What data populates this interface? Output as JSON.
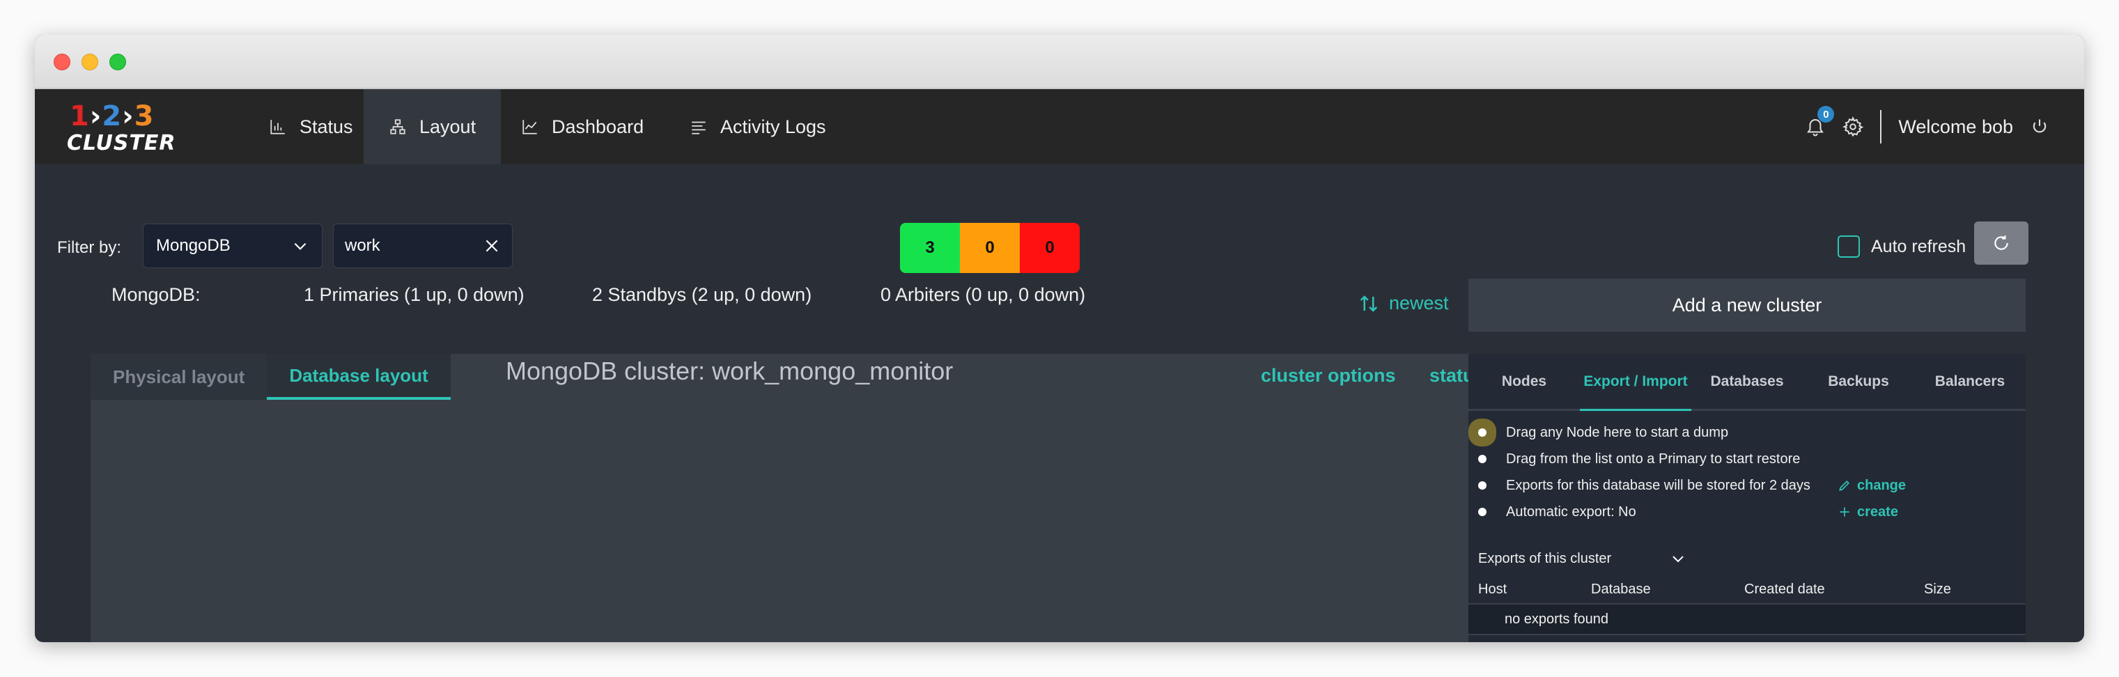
{
  "brand": {
    "logo_num1": "1",
    "logo_num2": "2",
    "logo_num3": "3",
    "logo_word": "CLUSTER",
    "colors": {
      "num1": "#e02424",
      "num2": "#3b8ad6",
      "num3": "#f08a24",
      "arrows": "#ffffff"
    }
  },
  "nav": {
    "items": [
      {
        "label": "Status",
        "icon": "bar-chart-icon"
      },
      {
        "label": "Layout",
        "icon": "sitemap-icon",
        "active": true
      },
      {
        "label": "Dashboard",
        "icon": "line-chart-icon"
      },
      {
        "label": "Activity Logs",
        "icon": "list-icon"
      }
    ],
    "notification_count": "0",
    "welcome": "Welcome bob"
  },
  "filter": {
    "label": "Filter by:",
    "selected_db": "MongoDB",
    "search_value": "work"
  },
  "counters": {
    "up": {
      "value": "3",
      "color": "#16e34c"
    },
    "warn": {
      "value": "0",
      "color": "#ff9d0a"
    },
    "down": {
      "value": "0",
      "color": "#ff1111"
    }
  },
  "auto_refresh": {
    "label": "Auto refresh",
    "checked": false
  },
  "summary": {
    "db": "MongoDB:",
    "primaries": "1 Primaries (1 up, 0 down)",
    "standbys": "2 Standbys (2 up, 0 down)",
    "arbiters": "0 Arbiters (0 up, 0 down)"
  },
  "sort": {
    "label": "newest"
  },
  "add_cluster_label": "Add a new cluster",
  "layout_panel": {
    "tabs": [
      "Physical layout",
      "Database layout"
    ],
    "active_tab": 1,
    "cluster_title": "MongoDB cluster: work_mongo_monitor",
    "cluster_options": "cluster options",
    "status": "status"
  },
  "right_panel": {
    "tabs": [
      "Nodes",
      "Export / Import",
      "Databases",
      "Backups",
      "Balancers"
    ],
    "active_tab": 1,
    "bullets": [
      "Drag any Node here to start a dump",
      "Drag from the list onto a Primary to start restore",
      "Exports for this database will be stored for 2 days",
      "Automatic export: No"
    ],
    "change_label": "change",
    "create_label": "create",
    "exports_label": "Exports of this cluster",
    "columns": [
      "Host",
      "Database",
      "Created date",
      "Size"
    ],
    "empty_text": "no exports found"
  }
}
